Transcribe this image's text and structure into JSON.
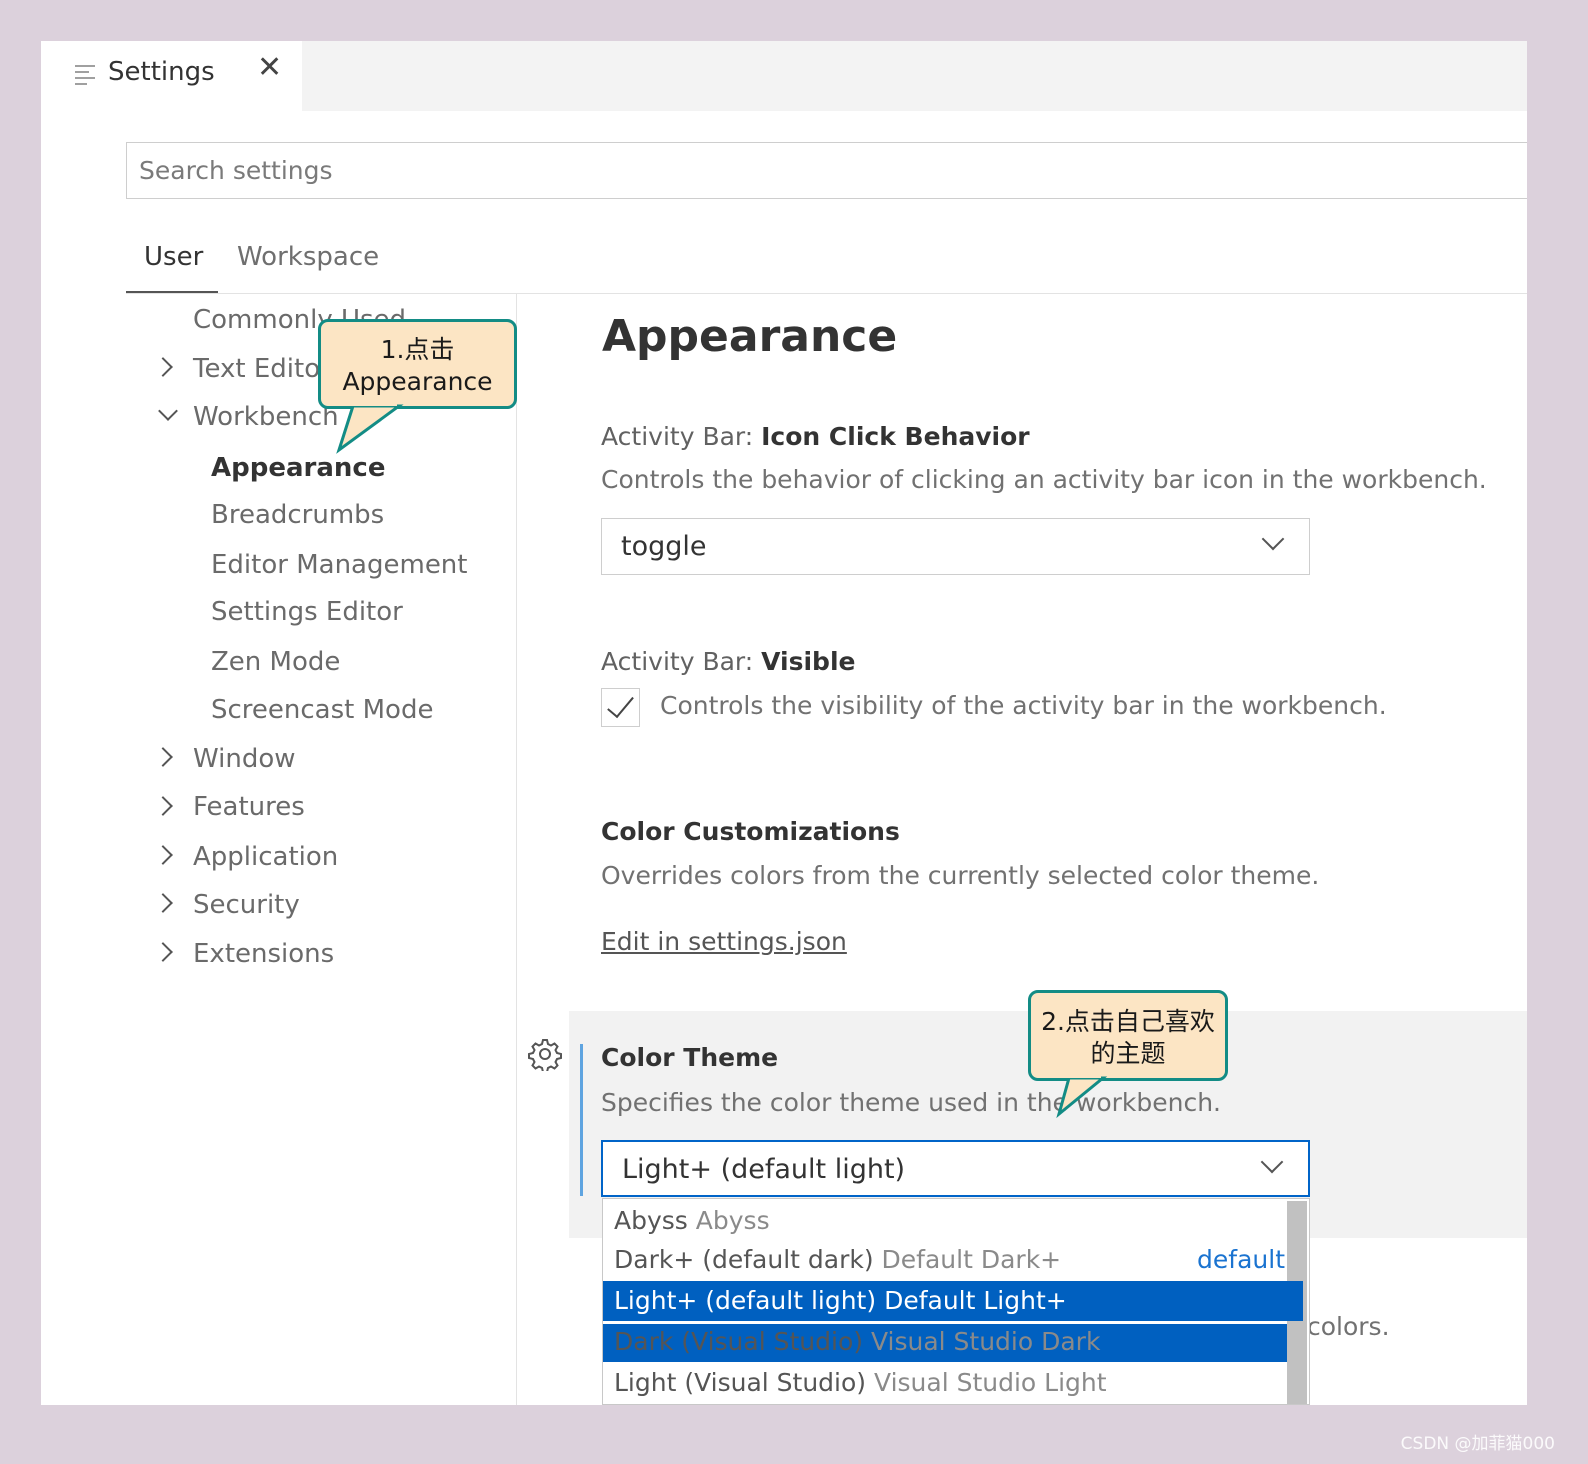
{
  "tab": {
    "label": "Settings",
    "close": "✕"
  },
  "search": {
    "placeholder": "Search settings"
  },
  "scopes": {
    "user": "User",
    "workspace": "Workspace"
  },
  "toc": {
    "commonly_used": "Commonly Used",
    "text_editor": "Text Editor",
    "workbench": "Workbench",
    "sub": [
      "Appearance",
      "Breadcrumbs",
      "Editor Management",
      "Settings Editor",
      "Zen Mode",
      "Screencast Mode"
    ],
    "window": "Window",
    "features": "Features",
    "application": "Application",
    "security": "Security",
    "extensions": "Extensions"
  },
  "callouts": {
    "one_line1": "1.点击",
    "one_line2": "Appearance",
    "two_line1": "2.点击自己喜欢",
    "two_line2": "的主题"
  },
  "main": {
    "heading": "Appearance",
    "icon_click": {
      "category": "Activity Bar: ",
      "name": "Icon Click Behavior",
      "desc": "Controls the behavior of clicking an activity bar icon in the workbench.",
      "value": "toggle"
    },
    "visible": {
      "category": "Activity Bar: ",
      "name": "Visible",
      "desc": "Controls the visibility of the activity bar in the workbench.",
      "checked": true
    },
    "color_customizations": {
      "name": "Color Customizations",
      "desc": "Overrides colors from the currently selected color theme.",
      "link": "Edit in settings.json"
    },
    "color_theme": {
      "name": "Color Theme",
      "desc": "Specifies the color theme used in the workbench.",
      "value": "Light+ (default light)",
      "options": [
        {
          "label": "Abyss",
          "detail": "Abyss",
          "tag": ""
        },
        {
          "label": "Dark+ (default dark)",
          "detail": "Default Dark+",
          "tag": "default"
        },
        {
          "label": "Light+ (default light)",
          "detail": "Default Light+",
          "tag": ""
        },
        {
          "label": "Dark (Visual Studio)",
          "detail": "Visual Studio Dark",
          "tag": ""
        },
        {
          "label": "Light (Visual Studio)",
          "detail": "Visual Studio Light",
          "tag": ""
        }
      ],
      "selected_index": 2
    },
    "partial_text": "colors."
  },
  "watermark": "CSDN @加菲猫000",
  "colors": {
    "accent": "#0060c0",
    "focus_border": "#0064c8",
    "callout_fill": "#fce5c4",
    "callout_border": "#138c85"
  }
}
